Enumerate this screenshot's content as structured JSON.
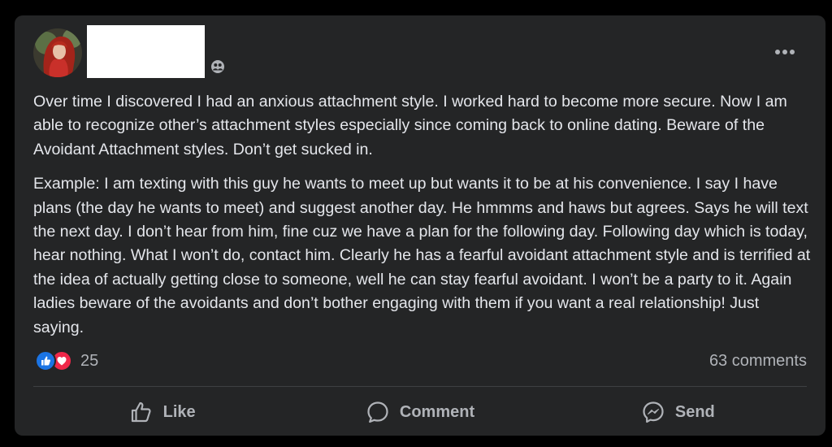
{
  "post": {
    "more_icon": "more-horizontal-icon",
    "audience_icon": "friends-audience-icon",
    "paragraphs": [
      "Over time I discovered I had an anxious attachment style. I worked hard to become more secure. Now I am able to recognize other’s attachment styles especially since coming back to online dating. Beware of the Avoidant Attachment styles. Don’t get sucked in.",
      "Example: I am texting with this guy he wants to meet up but wants it to be at his convenience. I say I have plans (the day he wants to meet) and suggest another day. He hmmms and haws but agrees. Says he will text the next day. I don’t hear from him, fine cuz we have a plan for the following day. Following day which is today, hear nothing. What I won’t do, contact him. Clearly he has a fearful avoidant attachment style and is terrified at the idea of actually getting close to someone, well he can stay fearful avoidant. I won’t be a party to it. Again ladies beware of the avoidants and don’t bother engaging with them if you want a real relationship! Just saying."
    ]
  },
  "stats": {
    "reaction_icons": [
      "like-reaction-icon",
      "love-reaction-icon"
    ],
    "reaction_count": "25",
    "comments": "63 comments"
  },
  "actions": {
    "like": "Like",
    "comment": "Comment",
    "send": "Send"
  },
  "colors": {
    "page_background": "#000000",
    "card_background": "#242526",
    "primary_text": "#e4e6eb",
    "secondary_text": "#b0b3b8",
    "like_blue": "#1b74e4",
    "love_red": "#f0284a"
  }
}
